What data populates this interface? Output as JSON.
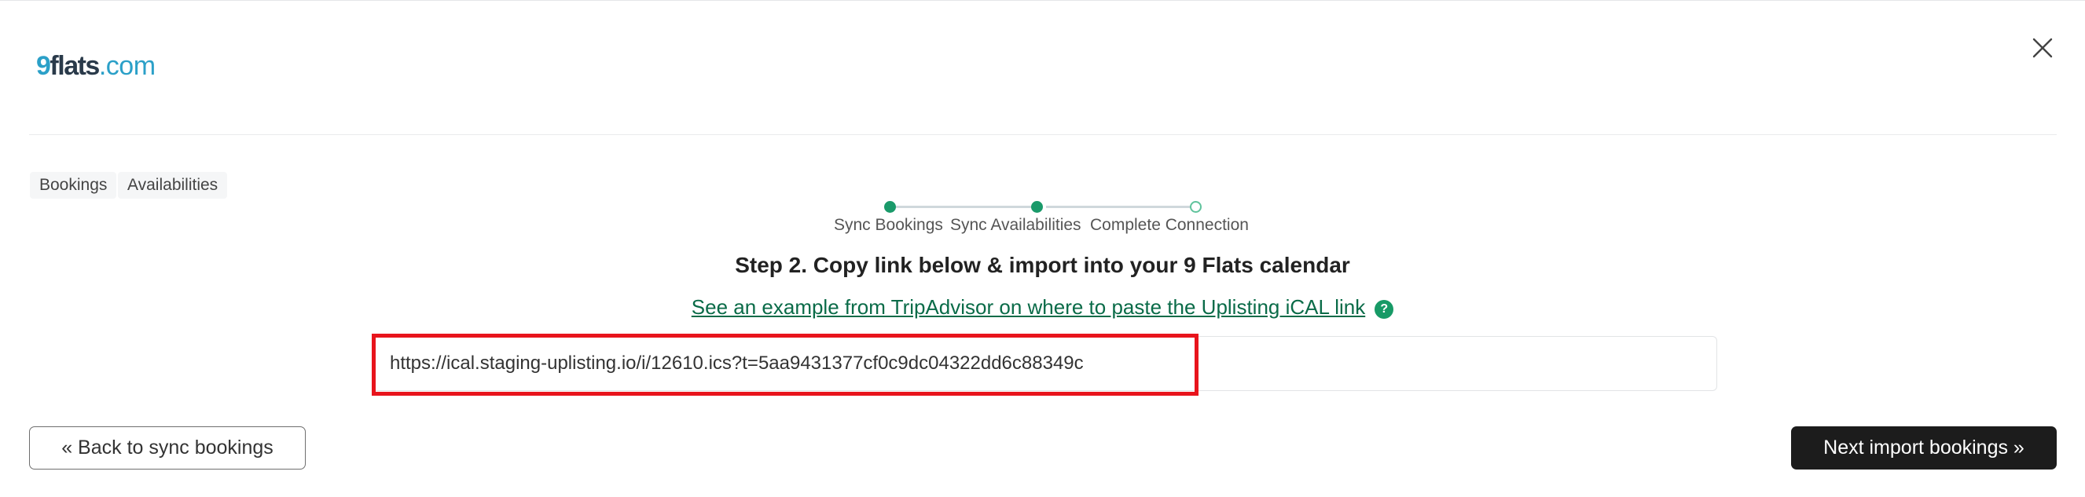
{
  "brand": {
    "logo_num": "9",
    "logo_word": "flats",
    "logo_tld": ".com"
  },
  "tabs": [
    {
      "label": "Bookings"
    },
    {
      "label": "Availabilities"
    }
  ],
  "stepper": {
    "steps": [
      {
        "label": "Sync Bookings",
        "status": "done"
      },
      {
        "label": "Sync Availabilities",
        "status": "done"
      },
      {
        "label": "Complete Connection",
        "status": "pending"
      }
    ],
    "done_color": "#1a9a6a",
    "pending_color": "#5fc39c"
  },
  "heading": "Step 2. Copy link below & import into your 9 Flats calendar",
  "example_link": "See an example from TripAdvisor on where to paste the Uplisting iCAL link",
  "help_icon": {
    "icon": "question-circle-icon",
    "glyph": "?"
  },
  "ical_url": "https://ical.staging-uplisting.io/i/12610.ics?t=5aa9431377cf0c9dc04322dd6c88349c",
  "buttons": {
    "back": "« Back to sync bookings",
    "next": "Next import bookings »"
  },
  "colors": {
    "accent": "#0a6b48",
    "highlight_border": "#e8141c",
    "primary_button": "#1c1c1c",
    "logo_blue": "#2ba0c8"
  }
}
